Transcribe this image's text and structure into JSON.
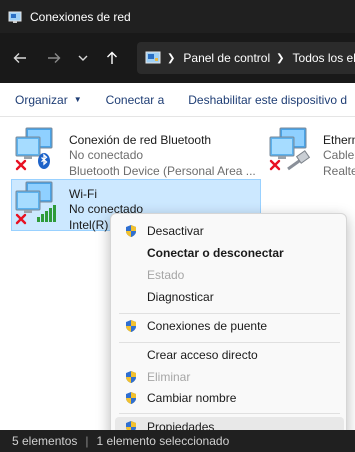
{
  "window": {
    "title": "Conexiones de red"
  },
  "address": {
    "crumbs": [
      "Panel de control",
      "Todos los ele"
    ]
  },
  "commands": {
    "organize": "Organizar",
    "connect_to": "Conectar a",
    "disable": "Deshabilitar este dispositivo d"
  },
  "items": [
    {
      "name": "Conexión de red Bluetooth",
      "status": "No conectado",
      "device": "Bluetooth Device (Personal Area ..."
    },
    {
      "name": "Wi-Fi",
      "status": "No conectado",
      "device": "Intel(R)"
    },
    {
      "name": "Ethern",
      "status": "Cable",
      "device": "Realte"
    }
  ],
  "context_menu": {
    "items": [
      {
        "label": "Desactivar",
        "shield": true,
        "bold": false,
        "disabled": false
      },
      {
        "label": "Conectar o desconectar",
        "shield": false,
        "bold": true,
        "disabled": false
      },
      {
        "label": "Estado",
        "shield": false,
        "bold": false,
        "disabled": true
      },
      {
        "label": "Diagnosticar",
        "shield": false,
        "bold": false,
        "disabled": false
      },
      {
        "label": "Conexiones de puente",
        "shield": true,
        "bold": false,
        "disabled": false
      },
      {
        "label": "Crear acceso directo",
        "shield": false,
        "bold": false,
        "disabled": false
      },
      {
        "label": "Eliminar",
        "shield": true,
        "bold": false,
        "disabled": true
      },
      {
        "label": "Cambiar nombre",
        "shield": true,
        "bold": false,
        "disabled": false
      },
      {
        "label": "Propiedades",
        "shield": true,
        "bold": false,
        "disabled": false,
        "highlighted": true
      }
    ]
  },
  "status": {
    "count": "5 elementos",
    "selection": "1 elemento seleccionado"
  },
  "colors": {
    "selection": "#cce8ff",
    "selection_border": "#99d1ff",
    "accent_text": "#1f3e75",
    "error_x": "#e81123"
  }
}
